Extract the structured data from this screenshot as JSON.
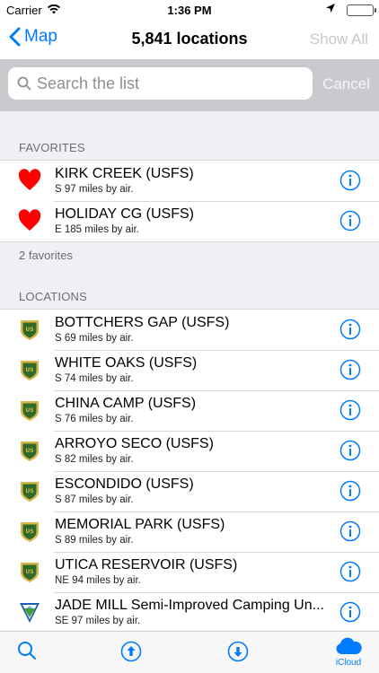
{
  "status": {
    "carrier": "Carrier",
    "time": "1:36 PM"
  },
  "nav": {
    "back_label": "Map",
    "title": "5,841 locations",
    "show_all": "Show All"
  },
  "search": {
    "placeholder": "Search the list",
    "cancel": "Cancel"
  },
  "favorites": {
    "header": "FAVORITES",
    "footer": "2 favorites",
    "items": [
      {
        "name": "KIRK CREEK (USFS)",
        "detail": "S 97 miles by air.",
        "icon": "heart-icon"
      },
      {
        "name": "HOLIDAY CG (USFS)",
        "detail": "E 185 miles by air.",
        "icon": "heart-icon"
      }
    ]
  },
  "locations": {
    "header": "LOCATIONS",
    "items": [
      {
        "name": "BOTTCHERS GAP (USFS)",
        "detail": "S 69 miles by air.",
        "icon": "usfs-shield-icon"
      },
      {
        "name": "WHITE OAKS (USFS)",
        "detail": "S 74 miles by air.",
        "icon": "usfs-shield-icon"
      },
      {
        "name": "CHINA CAMP (USFS)",
        "detail": "S 76 miles by air.",
        "icon": "usfs-shield-icon"
      },
      {
        "name": "ARROYO SECO (USFS)",
        "detail": "S 82 miles by air.",
        "icon": "usfs-shield-icon"
      },
      {
        "name": "ESCONDIDO (USFS)",
        "detail": "S 87 miles by air.",
        "icon": "usfs-shield-icon"
      },
      {
        "name": "MEMORIAL PARK (USFS)",
        "detail": "S 89 miles by air.",
        "icon": "usfs-shield-icon"
      },
      {
        "name": "UTICA RESERVOIR (USFS)",
        "detail": "NE 94 miles by air.",
        "icon": "usfs-shield-icon"
      },
      {
        "name": "JADE MILL Semi-Improved Camping Un...",
        "detail": "SE 97 miles by air.",
        "icon": "blm-shield-icon"
      }
    ]
  },
  "tabbar": {
    "icloud_label": "iCloud"
  },
  "colors": {
    "accent": "#007aff",
    "heart": "#ff0000",
    "usfs_green": "#2e6b2a",
    "usfs_gold": "#d9b648"
  }
}
